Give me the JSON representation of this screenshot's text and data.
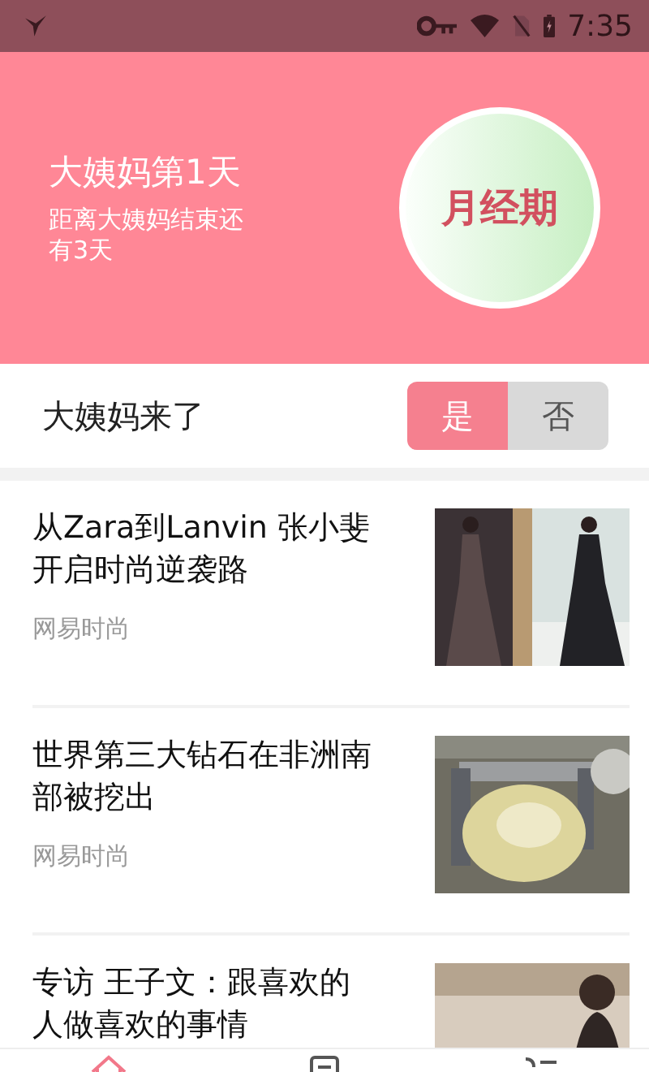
{
  "status_bar": {
    "time": "7:35"
  },
  "header": {
    "title": "大姨妈第1天",
    "subtitle": "距离大姨妈结束还有3天",
    "circle_label": "月经期"
  },
  "period_toggle": {
    "label": "大姨妈来了",
    "options": [
      {
        "label": "是",
        "selected": true
      },
      {
        "label": "否",
        "selected": false
      }
    ]
  },
  "articles": [
    {
      "title": "从Zara到Lanvin 张小斐开启时尚逆袭路",
      "source": "网易时尚"
    },
    {
      "title": "世界第三大钻石在非洲南部被挖出",
      "source": "网易时尚"
    },
    {
      "title": "专访 王子文：跟喜欢的人做喜欢的事情"
    }
  ],
  "bottom_nav": [
    {
      "selected": true
    },
    {
      "selected": false
    },
    {
      "selected": false
    }
  ]
}
